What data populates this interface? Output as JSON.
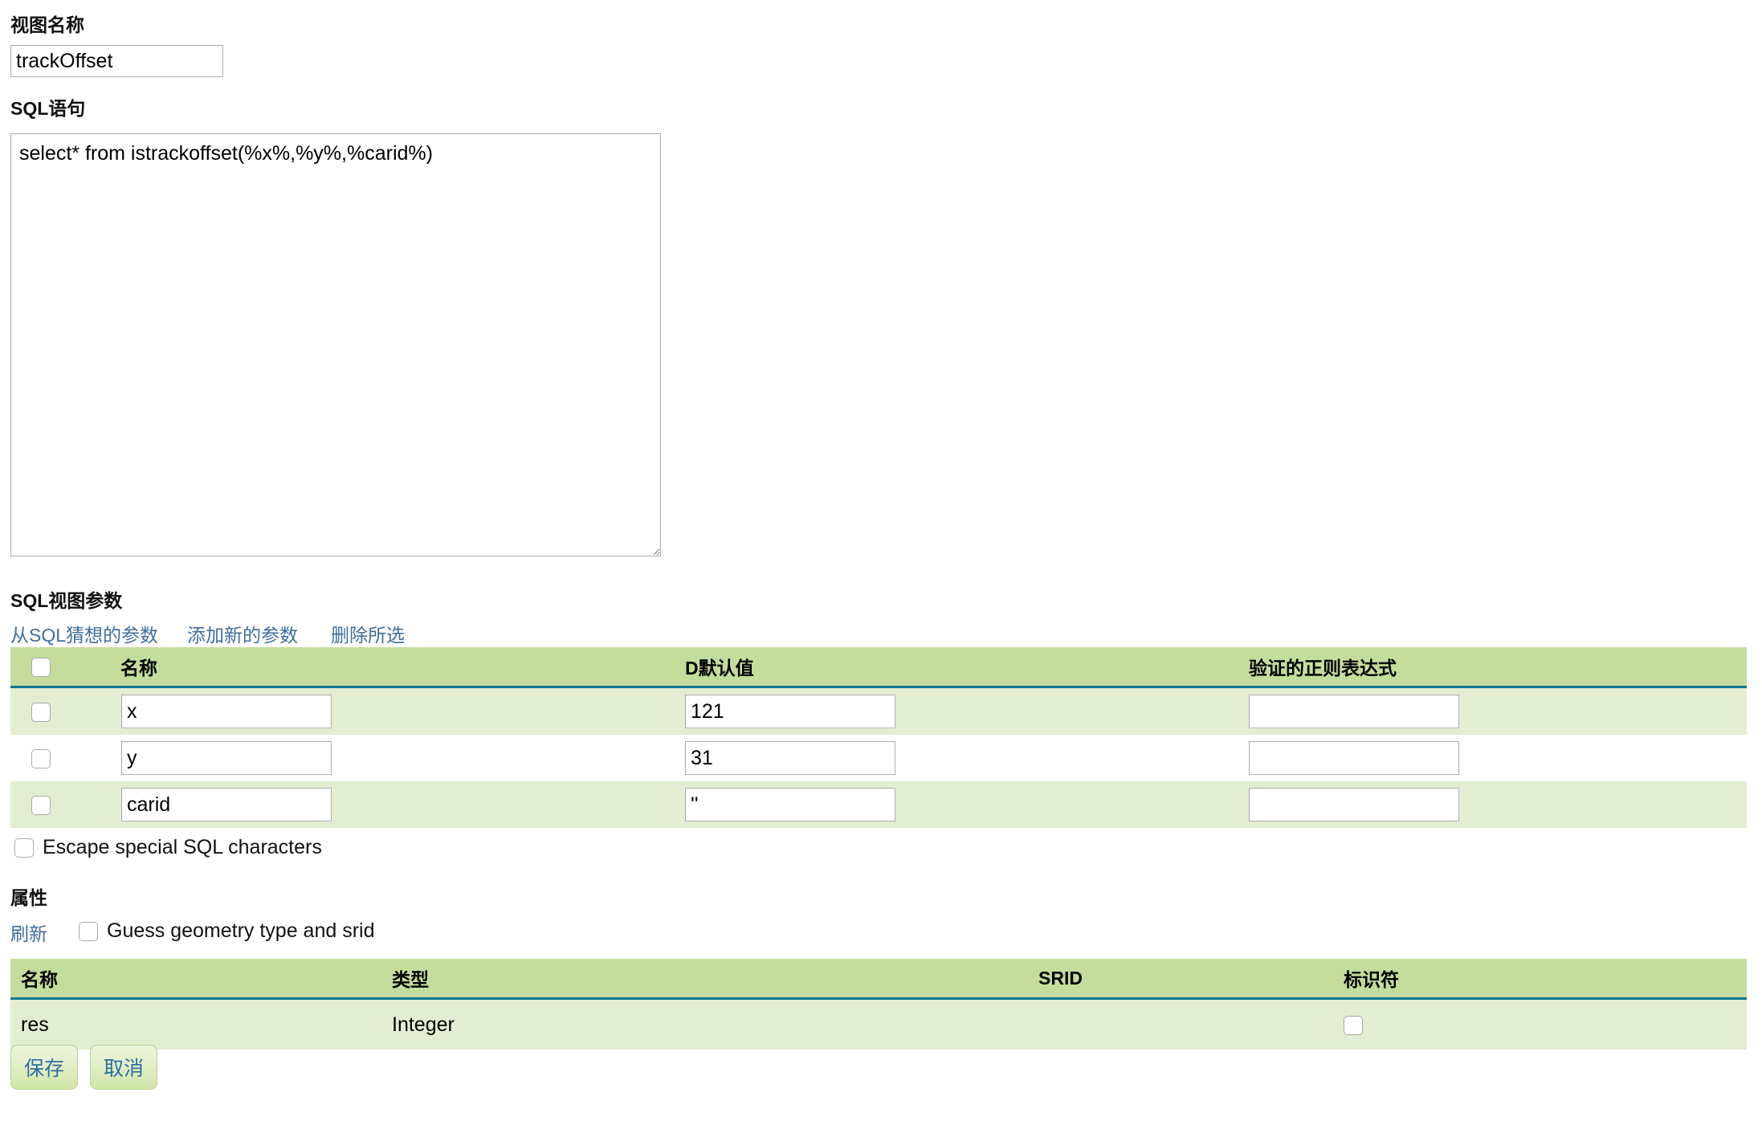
{
  "form": {
    "view_name_label": "视图名称",
    "view_name_value": "trackOffset",
    "sql_label": "SQL语句",
    "sql_value": "select* from istrackoffset(%x%,%y%,%carid%)"
  },
  "params_section": {
    "title": "SQL视图参数",
    "links": [
      {
        "label": "从SQL猜想的参数"
      },
      {
        "label": "添加新的参数"
      },
      {
        "label": "删除所选"
      }
    ],
    "columns": [
      "",
      "名称",
      "D默认值",
      "验证的正则表达式"
    ],
    "rows": [
      {
        "selected": false,
        "name": "x",
        "default": "121",
        "regex": ""
      },
      {
        "selected": false,
        "name": "y",
        "default": "31",
        "regex": ""
      },
      {
        "selected": false,
        "name": "carid",
        "default": "''",
        "regex": ""
      }
    ],
    "escape_checkbox_label": "Escape special SQL characters",
    "escape_checkbox_checked": false,
    "select_all_checked": false
  },
  "attrs_section": {
    "title": "属性",
    "refresh_link": "刷新",
    "guess_checkbox_label": "Guess geometry type and srid",
    "guess_checkbox_checked": false,
    "columns": [
      "名称",
      "类型",
      "SRID",
      "标识符"
    ],
    "rows": [
      {
        "name": "res",
        "type": "Integer",
        "srid": "",
        "identifier_checked": false
      }
    ]
  },
  "footer": {
    "save_label": "保存",
    "cancel_label": "取消"
  },
  "colors": {
    "header_green": "#c5dd9c",
    "row_green": "#e3edd2",
    "header_rule": "#0d7796",
    "link_blue": "#3f6d9e",
    "button_text": "#2f6ea5"
  }
}
